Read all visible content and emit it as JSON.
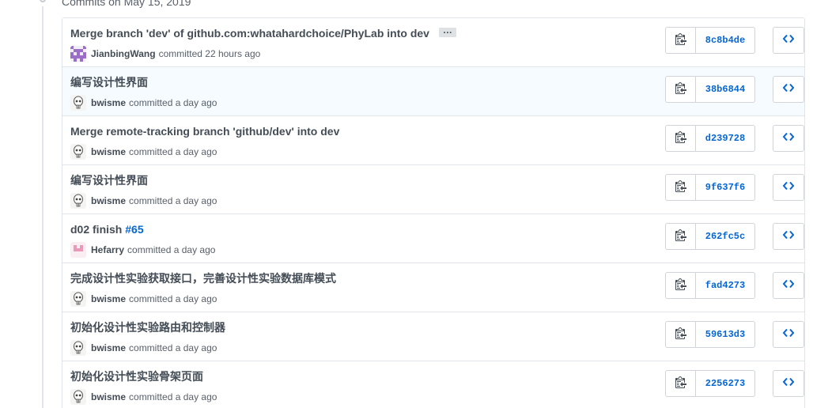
{
  "group": {
    "title": "Commits on May 15, 2019"
  },
  "colors": {
    "link": "#0366d6",
    "border": "#e1e4e8",
    "highlight_row": "#f6fbff"
  },
  "commits": [
    {
      "title": "Merge branch 'dev' of github.com:whatahardchoice/PhyLab into dev",
      "issue": "",
      "has_ellipsis": true,
      "ellipsis_label": "…",
      "author": "JianbingWang",
      "avatar": "identicon-purple",
      "action": "committed",
      "time": "22 hours ago",
      "sha": "8c8b4de",
      "highlight": false
    },
    {
      "title": "编写设计性界面",
      "issue": "",
      "has_ellipsis": false,
      "author": "bwisme",
      "avatar": "skull-avatar",
      "action": "committed",
      "time": "a day ago",
      "sha": "38b6844",
      "highlight": true
    },
    {
      "title": "Merge remote-tracking branch 'github/dev' into dev",
      "issue": "",
      "has_ellipsis": false,
      "author": "bwisme",
      "avatar": "skull-avatar",
      "action": "committed",
      "time": "a day ago",
      "sha": "d239728",
      "highlight": false
    },
    {
      "title": "编写设计性界面",
      "issue": "",
      "has_ellipsis": false,
      "author": "bwisme",
      "avatar": "skull-avatar",
      "action": "committed",
      "time": "a day ago",
      "sha": "9f637f6",
      "highlight": false
    },
    {
      "title": "d02 finish",
      "issue": "#65",
      "has_ellipsis": false,
      "author": "Hefarry",
      "avatar": "identicon-pink",
      "action": "committed",
      "time": "a day ago",
      "sha": "262fc5c",
      "highlight": false
    },
    {
      "title": "完成设计性实验获取接口，完善设计性实验数据库模式",
      "issue": "",
      "has_ellipsis": false,
      "author": "bwisme",
      "avatar": "skull-avatar",
      "action": "committed",
      "time": "a day ago",
      "sha": "fad4273",
      "highlight": false
    },
    {
      "title": "初始化设计性实验路由和控制器",
      "issue": "",
      "has_ellipsis": false,
      "author": "bwisme",
      "avatar": "skull-avatar",
      "action": "committed",
      "time": "a day ago",
      "sha": "59613d3",
      "highlight": false
    },
    {
      "title": "初始化设计性实验骨架页面",
      "issue": "",
      "has_ellipsis": false,
      "author": "bwisme",
      "avatar": "skull-avatar",
      "action": "committed",
      "time": "a day ago",
      "sha": "2256273",
      "highlight": false
    }
  ]
}
